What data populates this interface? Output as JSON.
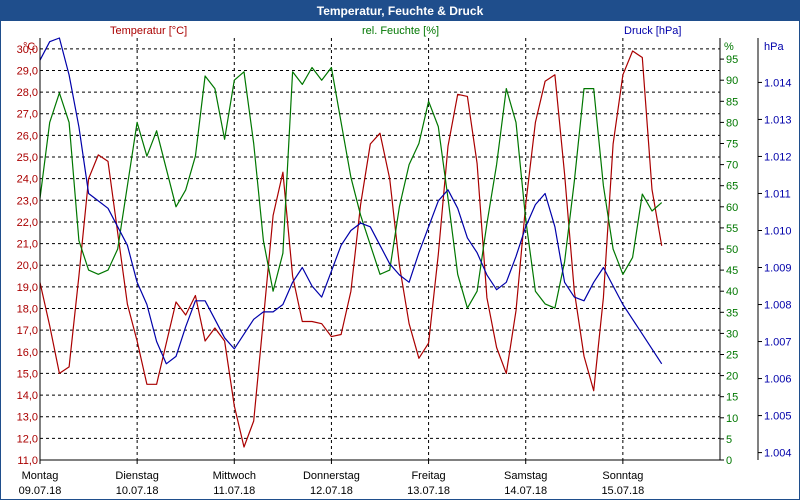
{
  "window": {
    "title": "Temperatur, Feuchte & Druck"
  },
  "chart_data": {
    "type": "line",
    "title": "Temperatur, Feuchte & Druck",
    "grid": true,
    "days": [
      {
        "name": "Montag",
        "date": "09.07.18"
      },
      {
        "name": "Dienstag",
        "date": "10.07.18"
      },
      {
        "name": "Mittwoch",
        "date": "11.07.18"
      },
      {
        "name": "Donnerstag",
        "date": "12.07.18"
      },
      {
        "name": "Freitag",
        "date": "13.07.18"
      },
      {
        "name": "Samstag",
        "date": "14.07.18"
      },
      {
        "name": "Sonntag",
        "date": "15.07.18"
      }
    ],
    "axes": {
      "temperature": {
        "label": "Temperatur [°C]",
        "unit": "°C",
        "min": 11,
        "max": 30.5,
        "ticks": [
          "30,0",
          "29,0",
          "28,0",
          "27,0",
          "26,0",
          "25,0",
          "24,0",
          "23,0",
          "22,0",
          "21,0",
          "20,0",
          "19,0",
          "18,0",
          "17,0",
          "16,0",
          "15,0",
          "14,0",
          "13,0",
          "12,0",
          "11,0"
        ],
        "color": "#aa0000"
      },
      "humidity": {
        "label": "rel. Feuchte [%]",
        "unit": "%",
        "min": 0,
        "max": 100,
        "ticks": [
          "95",
          "90",
          "85",
          "80",
          "75",
          "70",
          "65",
          "60",
          "55",
          "50",
          "45",
          "40",
          "35",
          "30",
          "25",
          "20",
          "15",
          "10",
          "5",
          "0"
        ],
        "color": "#007700"
      },
      "pressure": {
        "label": "Druck [hPa]",
        "unit": "hPa",
        "min": 1003.8,
        "max": 1015.2,
        "ticks": [
          "1.014",
          "1.013",
          "1.012",
          "1.011",
          "1.010",
          "1.009",
          "1.008",
          "1.007",
          "1.006",
          "1.005",
          "1.004"
        ],
        "color": "#0000aa"
      }
    },
    "series": [
      {
        "name": "Temperatur [°C]",
        "axis": "temperature",
        "color": "#aa0000",
        "x": [
          0,
          0.1,
          0.2,
          0.3,
          0.4,
          0.5,
          0.6,
          0.7,
          0.8,
          0.9,
          1,
          1.1,
          1.2,
          1.3,
          1.4,
          1.5,
          1.6,
          1.7,
          1.8,
          1.9,
          2,
          2.1,
          2.2,
          2.3,
          2.4,
          2.5,
          2.6,
          2.7,
          2.8,
          2.9,
          3,
          3.1,
          3.2,
          3.3,
          3.4,
          3.5,
          3.6,
          3.7,
          3.8,
          3.9,
          4,
          4.1,
          4.2,
          4.3,
          4.4,
          4.5,
          4.6,
          4.7,
          4.8,
          4.9,
          5,
          5.1,
          5.2,
          5.3,
          5.4,
          5.5,
          5.6,
          5.7,
          5.8,
          5.9,
          6,
          6.1,
          6.2,
          6.3,
          6.4,
          6.5,
          6.6,
          6.7,
          6.8,
          6.9,
          7
        ],
        "y": [
          19.2,
          17.2,
          15.0,
          15.3,
          19.5,
          24.0,
          25.1,
          24.8,
          21.5,
          18.2,
          16.5,
          14.5,
          14.5,
          16.4,
          18.3,
          17.7,
          18.6,
          16.5,
          17.1,
          16.5,
          13.5,
          11.6,
          12.8,
          17.5,
          22.3,
          24.3,
          19.5,
          17.4,
          17.4,
          17.3,
          16.7,
          16.8,
          18.8,
          22.8,
          25.6,
          26.1,
          24.0,
          20.0,
          17.3,
          15.7,
          16.4,
          20.5,
          25.5,
          27.9,
          27.8,
          24.7,
          18.5,
          16.2,
          15.0,
          17.9,
          22.8,
          26.6,
          28.5,
          28.8,
          24.2,
          18.8,
          15.8,
          14.2,
          18.5,
          25.6,
          28.8,
          29.9,
          29.6,
          23.5,
          20.9,
          null,
          null,
          null,
          null,
          null,
          null
        ]
      },
      {
        "name": "rel. Feuchte [%]",
        "axis": "humidity",
        "color": "#007700",
        "x": [
          0,
          0.1,
          0.2,
          0.3,
          0.4,
          0.5,
          0.6,
          0.7,
          0.8,
          0.9,
          1,
          1.1,
          1.2,
          1.3,
          1.4,
          1.5,
          1.6,
          1.7,
          1.8,
          1.9,
          2,
          2.1,
          2.2,
          2.3,
          2.4,
          2.5,
          2.6,
          2.7,
          2.8,
          2.9,
          3,
          3.1,
          3.2,
          3.3,
          3.4,
          3.5,
          3.6,
          3.7,
          3.8,
          3.9,
          4,
          4.1,
          4.2,
          4.3,
          4.4,
          4.5,
          4.6,
          4.7,
          4.8,
          4.9,
          5,
          5.1,
          5.2,
          5.3,
          5.4,
          5.5,
          5.6,
          5.7,
          5.8,
          5.9,
          6,
          6.1,
          6.2,
          6.3,
          6.4,
          6.5,
          6.6,
          6.7,
          6.8,
          6.9,
          7
        ],
        "y": [
          62,
          80,
          87,
          80,
          52,
          45,
          44,
          45,
          50,
          65,
          80,
          72,
          78,
          69,
          60,
          64,
          72,
          91,
          88,
          76,
          90,
          92,
          75,
          52,
          40,
          49,
          92,
          89,
          93,
          90,
          93,
          80,
          67,
          58,
          51,
          44,
          45,
          60,
          70,
          75,
          85,
          79,
          62,
          44,
          36,
          40,
          56,
          70,
          88,
          80,
          57,
          40,
          37,
          36,
          47,
          66,
          88,
          88,
          65,
          50,
          44,
          48,
          63,
          59,
          61,
          null,
          null,
          null,
          null,
          null,
          null
        ]
      },
      {
        "name": "Druck [hPa]",
        "axis": "pressure",
        "color": "#0000aa",
        "x": [
          0,
          0.1,
          0.2,
          0.3,
          0.4,
          0.5,
          0.6,
          0.7,
          0.8,
          0.9,
          1,
          1.1,
          1.2,
          1.3,
          1.4,
          1.5,
          1.6,
          1.7,
          1.8,
          1.9,
          2,
          2.1,
          2.2,
          2.3,
          2.4,
          2.5,
          2.6,
          2.7,
          2.8,
          2.9,
          3,
          3.1,
          3.2,
          3.3,
          3.4,
          3.5,
          3.6,
          3.7,
          3.8,
          3.9,
          4,
          4.1,
          4.2,
          4.3,
          4.4,
          4.5,
          4.6,
          4.7,
          4.8,
          4.9,
          5,
          5.1,
          5.2,
          5.3,
          5.4,
          5.5,
          5.6,
          5.7,
          5.8,
          5.9,
          6,
          6.1,
          6.2,
          6.3,
          6.4,
          6.5,
          6.6,
          6.7,
          6.8,
          6.9,
          7
        ],
        "y": [
          1014.6,
          1015.1,
          1015.2,
          1014.2,
          1012.8,
          1011.0,
          1010.8,
          1010.6,
          1010.1,
          1009.6,
          1008.6,
          1008.0,
          1007.0,
          1006.4,
          1006.6,
          1007.4,
          1008.1,
          1008.1,
          1007.6,
          1007.1,
          1006.8,
          1007.2,
          1007.6,
          1007.8,
          1007.8,
          1008.0,
          1008.6,
          1009.0,
          1008.5,
          1008.2,
          1008.9,
          1009.6,
          1010.0,
          1010.2,
          1010.1,
          1009.6,
          1009.1,
          1008.8,
          1008.6,
          1009.4,
          1010.1,
          1010.8,
          1011.1,
          1010.6,
          1009.8,
          1009.4,
          1008.8,
          1008.4,
          1008.6,
          1009.3,
          1010.1,
          1010.7,
          1011.0,
          1010.1,
          1008.6,
          1008.2,
          1008.1,
          1008.6,
          1009.0,
          1008.5,
          1008.0,
          1007.6,
          1007.2,
          1006.8,
          1006.4,
          null,
          null,
          null,
          null,
          null,
          null
        ]
      }
    ]
  }
}
